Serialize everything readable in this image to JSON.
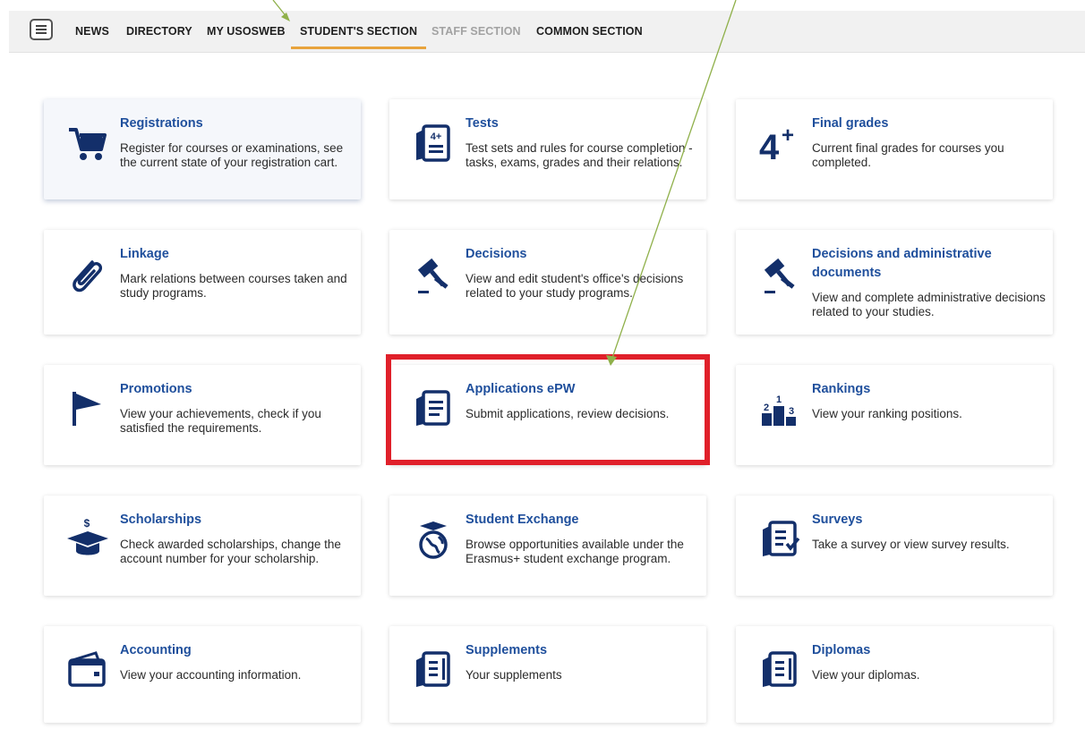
{
  "nav": {
    "items": [
      {
        "label": "NEWS"
      },
      {
        "label": "DIRECTORY"
      },
      {
        "label": "MY USOSWEB"
      },
      {
        "label": "STUDENT'S SECTION"
      },
      {
        "label": "STAFF SECTION"
      },
      {
        "label": "COMMON SECTION"
      }
    ],
    "active": "STUDENT'S SECTION",
    "disabled": "STAFF SECTION"
  },
  "tiles": [
    {
      "title": "Registrations",
      "desc": "Register for courses or examinations, see the current state of your registration cart.",
      "icon": "cart-icon"
    },
    {
      "title": "Tests",
      "desc": "Test sets and rules for course completion - tasks, exams, grades and their relations.",
      "icon": "test-sheet-icon"
    },
    {
      "title": "Final grades",
      "desc": "Current final grades for courses you completed.",
      "icon": "grade-four-plus-icon"
    },
    {
      "title": "Linkage",
      "desc": "Mark relations between courses taken and study programs.",
      "icon": "paperclip-icon"
    },
    {
      "title": "Decisions",
      "desc": "View and edit student's office's decisions related to your study programs.",
      "icon": "gavel-icon"
    },
    {
      "title": "Decisions and administrative documents",
      "desc": "View and complete administrative decisions related to your studies.",
      "icon": "gavel-icon"
    },
    {
      "title": "Promotions",
      "desc": "View your achievements, check if you satisfied the requirements.",
      "icon": "flag-icon"
    },
    {
      "title": "Applications ePW",
      "desc": "Submit applications, review decisions.",
      "icon": "document-icon"
    },
    {
      "title": "Rankings",
      "desc": "View your ranking positions.",
      "icon": "podium-icon"
    },
    {
      "title": "Scholarships",
      "desc": "Check awarded scholarships, change the account number for your scholarship.",
      "icon": "graduation-cap-dollar-icon"
    },
    {
      "title": "Student Exchange",
      "desc": "Browse opportunities available under the Erasmus+ student exchange program.",
      "icon": "globe-cap-icon"
    },
    {
      "title": "Surveys",
      "desc": "Take a survey or view survey results.",
      "icon": "survey-checklist-icon"
    },
    {
      "title": "Accounting",
      "desc": "View your accounting information.",
      "icon": "wallet-icon"
    },
    {
      "title": "Supplements",
      "desc": "Your supplements",
      "icon": "notebook-icon"
    },
    {
      "title": "Diplomas",
      "desc": "View your diplomas.",
      "icon": "notebook-icon"
    }
  ],
  "annotations": {
    "highlight_color": "#e0202a",
    "arrow_color": "#8fb04a"
  },
  "colors": {
    "title": "#1f4f9c",
    "icon": "#132f6a",
    "active_underline": "#e8a33c"
  }
}
